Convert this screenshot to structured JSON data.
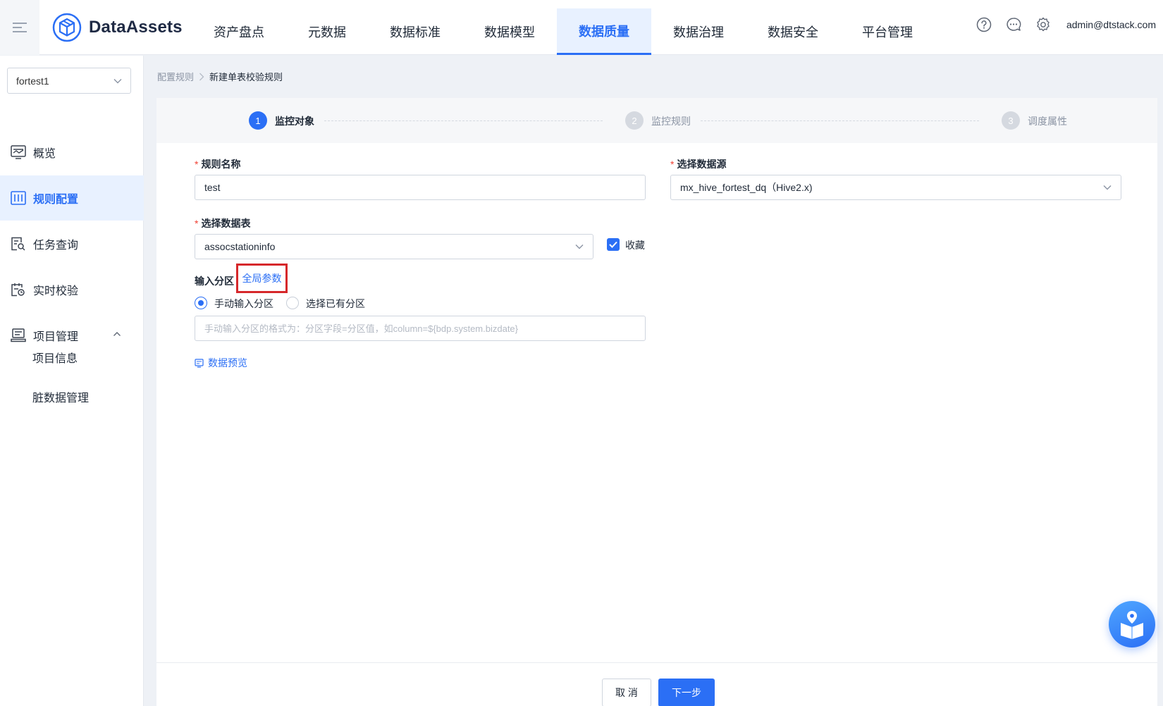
{
  "app": {
    "title": "DataAssets",
    "user_email": "admin@dtstack.com"
  },
  "nav": {
    "items": [
      {
        "label": "资产盘点"
      },
      {
        "label": "元数据"
      },
      {
        "label": "数据标准"
      },
      {
        "label": "数据模型"
      },
      {
        "label": "数据质量",
        "active": true
      },
      {
        "label": "数据治理"
      },
      {
        "label": "数据安全"
      },
      {
        "label": "平台管理"
      }
    ]
  },
  "sidebar": {
    "project": "fortest1",
    "items": [
      {
        "label": "概览",
        "icon": "overview-icon"
      },
      {
        "label": "规则配置",
        "icon": "rule-config-icon",
        "active": true
      },
      {
        "label": "任务查询",
        "icon": "task-query-icon"
      },
      {
        "label": "实时校验",
        "icon": "realtime-check-icon"
      },
      {
        "label": "项目管理",
        "icon": "project-manage-icon",
        "expanded": true
      }
    ],
    "sub_items": [
      {
        "label": "项目信息"
      },
      {
        "label": "脏数据管理"
      }
    ]
  },
  "breadcrumb": {
    "parent": "配置规则",
    "current": "新建单表校验规则"
  },
  "steps": [
    {
      "num": "1",
      "label": "监控对象",
      "active": true
    },
    {
      "num": "2",
      "label": "监控规则",
      "active": false
    },
    {
      "num": "3",
      "label": "调度属性",
      "active": false
    }
  ],
  "form": {
    "rule_name_label": "规则名称",
    "rule_name_value": "test",
    "datasource_label": "选择数据源",
    "datasource_value": "mx_hive_fortest_dq（Hive2.x)",
    "table_label": "选择数据表",
    "table_value": "assocstationinfo",
    "favorite_label": "收藏",
    "favorite_checked": true,
    "partition_label": "输入分区",
    "global_params_link": "全局参数",
    "radio_manual": "手动输入分区",
    "radio_existing": "选择已有分区",
    "partition_placeholder": "手动输入分区的格式为：分区字段=分区值，如column=${bdp.system.bizdate}",
    "preview_link": "数据预览"
  },
  "footer": {
    "cancel": "取 消",
    "next": "下一步"
  },
  "colors": {
    "primary": "#2b6ff5",
    "required": "#f04134",
    "highlight_box": "#d6282b"
  }
}
